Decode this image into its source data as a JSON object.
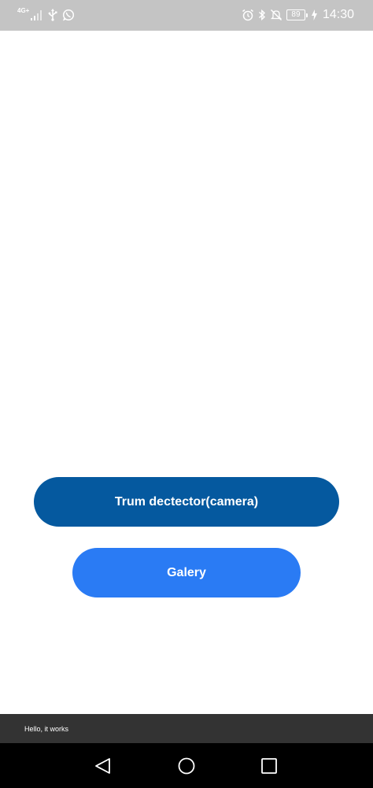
{
  "status_bar": {
    "network_type": "4G",
    "network_superscript": "+",
    "battery_level": "89",
    "time": "14:30",
    "icons": [
      "signal-icon",
      "usb-icon",
      "whatsapp-icon",
      "alarm-icon",
      "bluetooth-icon",
      "mute-icon",
      "battery-icon",
      "charging-icon"
    ]
  },
  "main": {
    "camera_button_label": "Trum dectector(camera)",
    "gallery_button_label": "Galery"
  },
  "snackbar": {
    "message": "Hello, it works"
  },
  "nav_bar": {
    "icons": [
      "back-icon",
      "home-icon",
      "recent-apps-icon"
    ]
  },
  "colors": {
    "status_bar": "#c4c4c4",
    "camera_button": "#05599f",
    "gallery_button": "#2a7bf4",
    "snackbar": "#333333",
    "nav_bar": "#000000"
  }
}
